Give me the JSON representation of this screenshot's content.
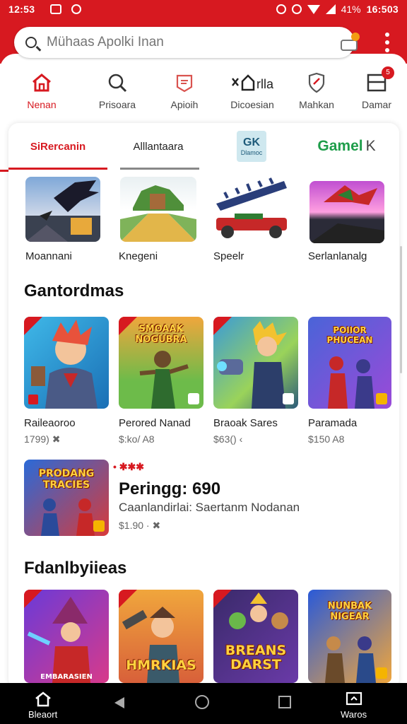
{
  "status": {
    "time": "12:53",
    "battery": "41%",
    "clock": "16:503"
  },
  "search": {
    "placeholder": "Mühaas Apolki Inan"
  },
  "nav": [
    {
      "label": "Nenan",
      "icon": "home-icon",
      "active": true
    },
    {
      "label": "Prisoara",
      "icon": "search-icon"
    },
    {
      "label": "Apioih",
      "icon": "news-icon"
    },
    {
      "label": "Dicoesian",
      "icon": "category-icon"
    },
    {
      "label": "Mahkan",
      "icon": "shield-icon"
    },
    {
      "label": "Damar",
      "icon": "window-icon",
      "badge": "5"
    }
  ],
  "tabs": [
    {
      "label": "SiRercanin",
      "active": true
    },
    {
      "label": "Alllantaara"
    },
    {
      "logo_top": "GK",
      "logo_bottom": "Dlamoc"
    },
    {
      "label": "Gamel",
      "suffix": "K"
    }
  ],
  "top_row": [
    {
      "caption": "Moannani",
      "art": "bat"
    },
    {
      "caption": "Knegeni",
      "art": "castle"
    },
    {
      "caption": "Speelr",
      "art": "car"
    },
    {
      "caption": "Serlanlanalg",
      "art": "dragon"
    }
  ],
  "section1": {
    "title": "Gantordmas",
    "items": [
      {
        "caption": "Raileaoroo",
        "price": "1799)  ✖"
      },
      {
        "caption": "Perored Nanad",
        "price": "$:ko/  A8",
        "art_text": "SMOAAK NOGUBRA"
      },
      {
        "caption": "Braoak Sares",
        "price": "$63() ‹"
      },
      {
        "caption": "Paramada",
        "price": "$150  A8",
        "art_text": "POIIOR PHUCEAN"
      }
    ]
  },
  "promo": {
    "tag": "• ✱✱✱",
    "title": "Peringg: 690",
    "subtitle": "Caanlandirlai: Saertanm Nodanan",
    "price": "$1.90 ·  ✖",
    "art_text": "PRODANG TRACIES"
  },
  "section2": {
    "title": "Fdanlbyiieas",
    "items": [
      {
        "art_text": "EMBARASIEN"
      },
      {
        "art_text": "HMRKIAS"
      },
      {
        "art_text": "BREANS DARST"
      },
      {
        "art_text": "NUNBAK NIGEAR"
      }
    ]
  },
  "bottom": {
    "home_label": "Bleaort",
    "apps_label": "Waros"
  }
}
